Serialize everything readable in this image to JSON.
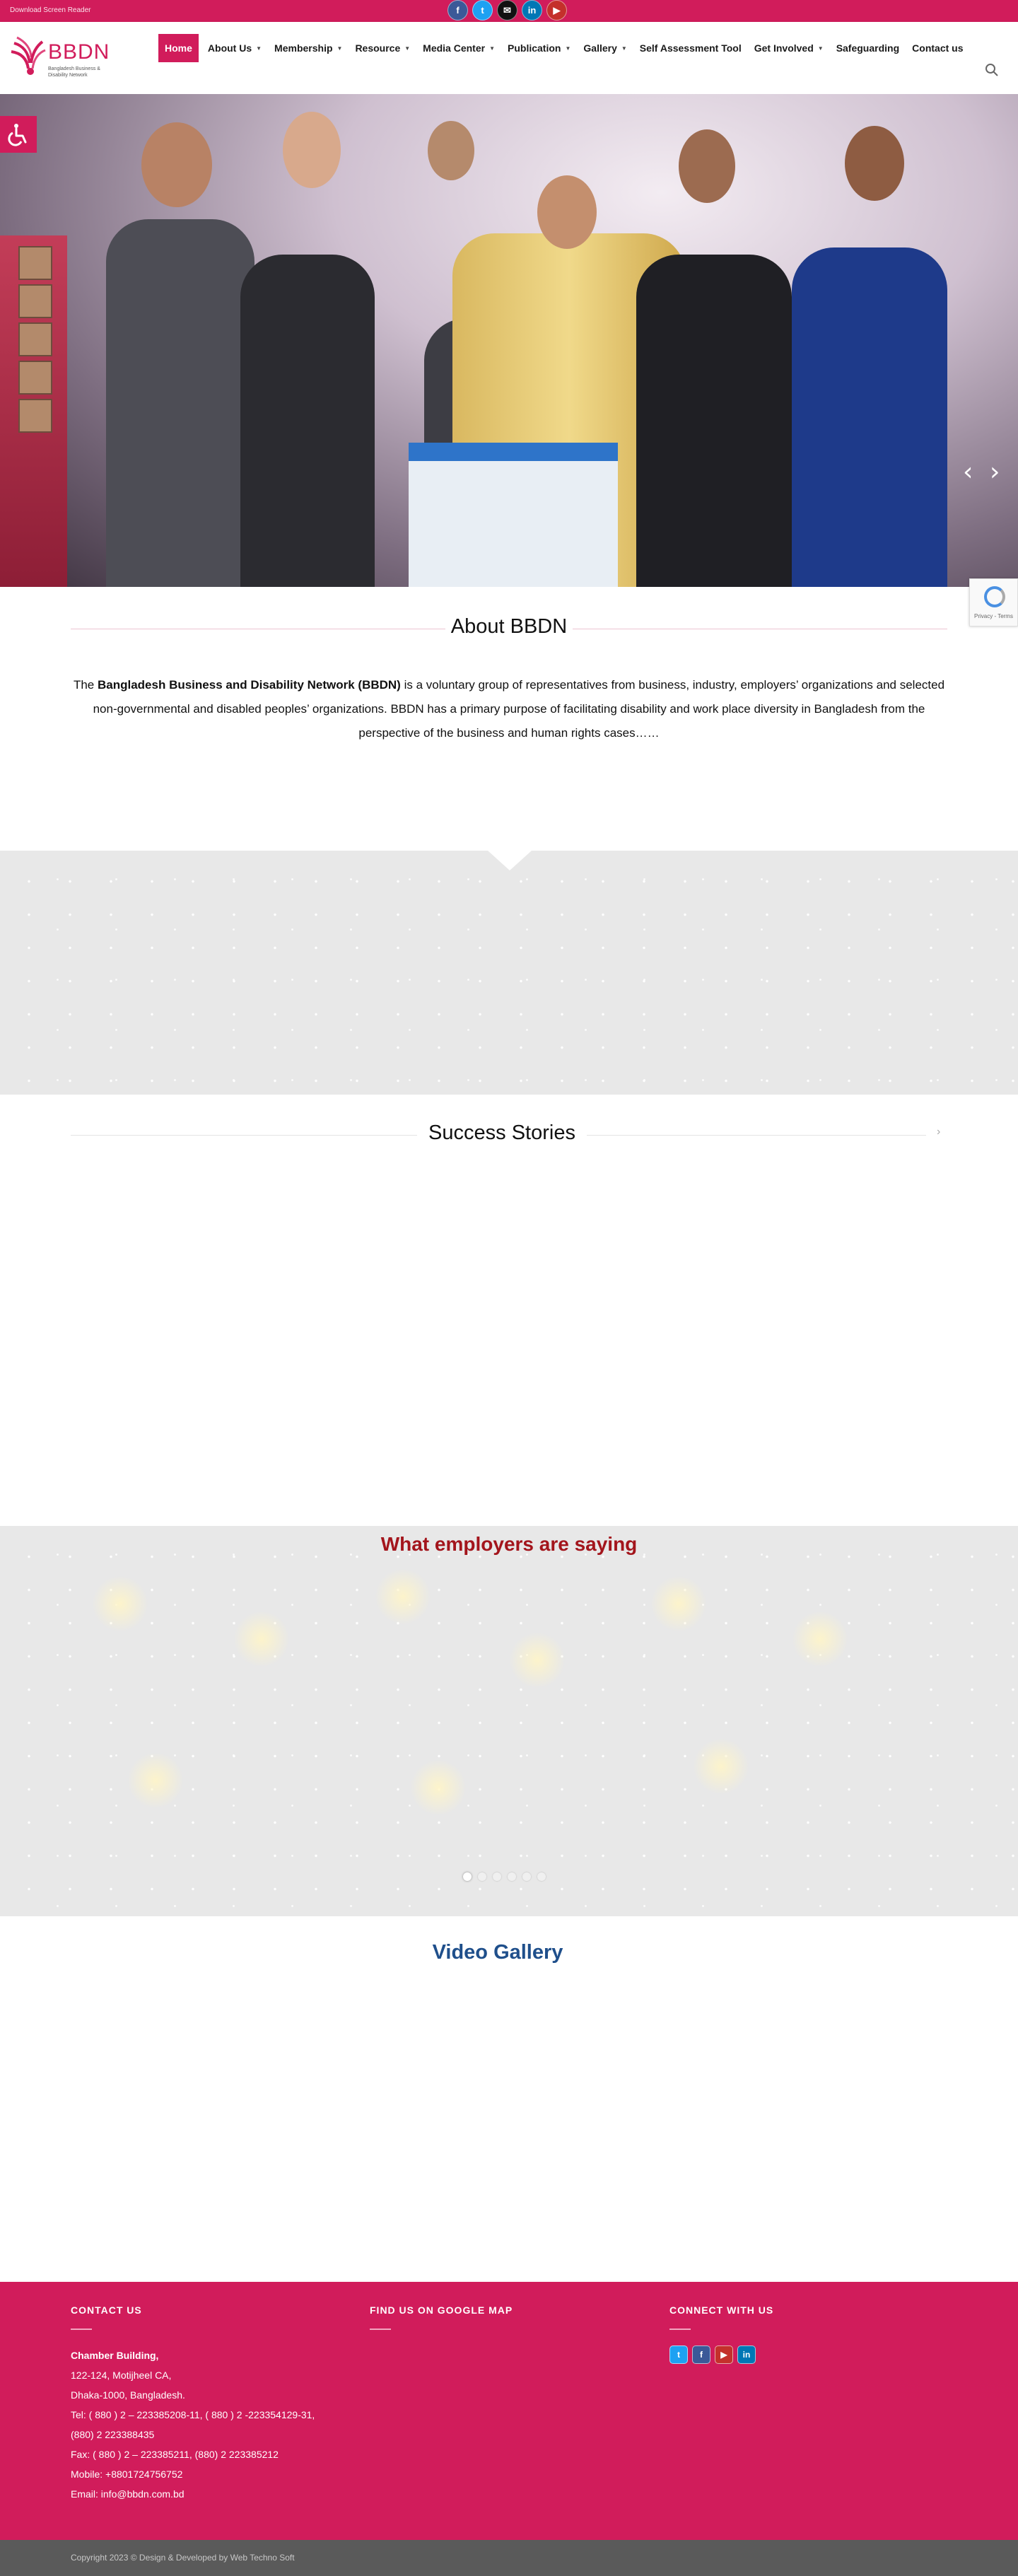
{
  "topbar": {
    "screen_reader_link": "Download Screen Reader",
    "socials": [
      {
        "icon": "facebook-icon",
        "glyph": "f",
        "color": "#3b5998"
      },
      {
        "icon": "twitter-icon",
        "glyph": "t",
        "color": "#1da1f2"
      },
      {
        "icon": "email-icon",
        "glyph": "✉",
        "color": "#111111"
      },
      {
        "icon": "linkedin-icon",
        "glyph": "in",
        "color": "#0077b5"
      },
      {
        "icon": "youtube-icon",
        "glyph": "▶",
        "color": "#c4302b"
      }
    ]
  },
  "header": {
    "logo": {
      "name": "BBDN",
      "tagline": "Bangladesh Business & Disability Network"
    },
    "nav": [
      {
        "label": "Home",
        "active": true,
        "dropdown": false
      },
      {
        "label": "About Us",
        "dropdown": true
      },
      {
        "label": "Membership",
        "dropdown": true
      },
      {
        "label": "Resource",
        "dropdown": true
      },
      {
        "label": "Media Center",
        "dropdown": true
      },
      {
        "label": "Publication",
        "dropdown": true
      },
      {
        "label": "Gallery",
        "dropdown": true
      },
      {
        "label": "Self Assessment Tool",
        "dropdown": false
      },
      {
        "label": "Get Involved",
        "dropdown": true
      },
      {
        "label": "Safeguarding",
        "dropdown": false
      },
      {
        "label": "Contact us",
        "dropdown": false
      }
    ]
  },
  "hero": {
    "prev": "‹",
    "next": "›"
  },
  "recaptcha": {
    "text": "Privacy - Terms"
  },
  "about": {
    "title": "About BBDN",
    "text_prefix": "The ",
    "text_bold": "Bangladesh Business and Disability Network (BBDN)",
    "text_rest": " is a voluntary group of representatives from business, industry, employers’ organizations and selected non-governmental and disabled peoples’ organizations. BBDN has a primary purpose of facilitating disability and work place diversity in Bangladesh from the perspective of the business and human rights cases……"
  },
  "success_stories": {
    "title": "Success Stories",
    "next": "›"
  },
  "employers": {
    "title": "What employers are saying",
    "slides": 6,
    "active_slide": 0
  },
  "video_gallery": {
    "title": "Video Gallery"
  },
  "footer": {
    "contact": {
      "heading": "CONTACT US",
      "building": "Chamber Building,",
      "lines": [
        "122-124, Motijheel CA,",
        "Dhaka-1000, Bangladesh.",
        "Tel: ( 880 ) 2 – 223385208-11, ( 880 ) 2 -223354129-31,",
        "(880) 2 223388435",
        "Fax: ( 880 ) 2 – 223385211, (880) 2 223385212",
        "Mobile: +8801724756752",
        "Email: info@bbdn.com.bd"
      ]
    },
    "map": {
      "heading": "FIND US ON GOOGLE MAP"
    },
    "connect": {
      "heading": "CONNECT WITH US",
      "icons": [
        {
          "icon": "twitter-icon",
          "glyph": "t",
          "color": "#1da1f2"
        },
        {
          "icon": "facebook-icon",
          "glyph": "f",
          "color": "#3b5998"
        },
        {
          "icon": "youtube-icon",
          "glyph": "▶",
          "color": "#c4302b"
        },
        {
          "icon": "linkedin-icon",
          "glyph": "in",
          "color": "#0077b5"
        }
      ]
    },
    "copyright": "Copyright 2023 © Design & Developed by Web Techno Soft"
  },
  "colors": {
    "brand": "#d11c5b",
    "footer_bottom": "#5a5a5a",
    "employers_title": "#a3151c",
    "video_title": "#1f4f8b"
  }
}
